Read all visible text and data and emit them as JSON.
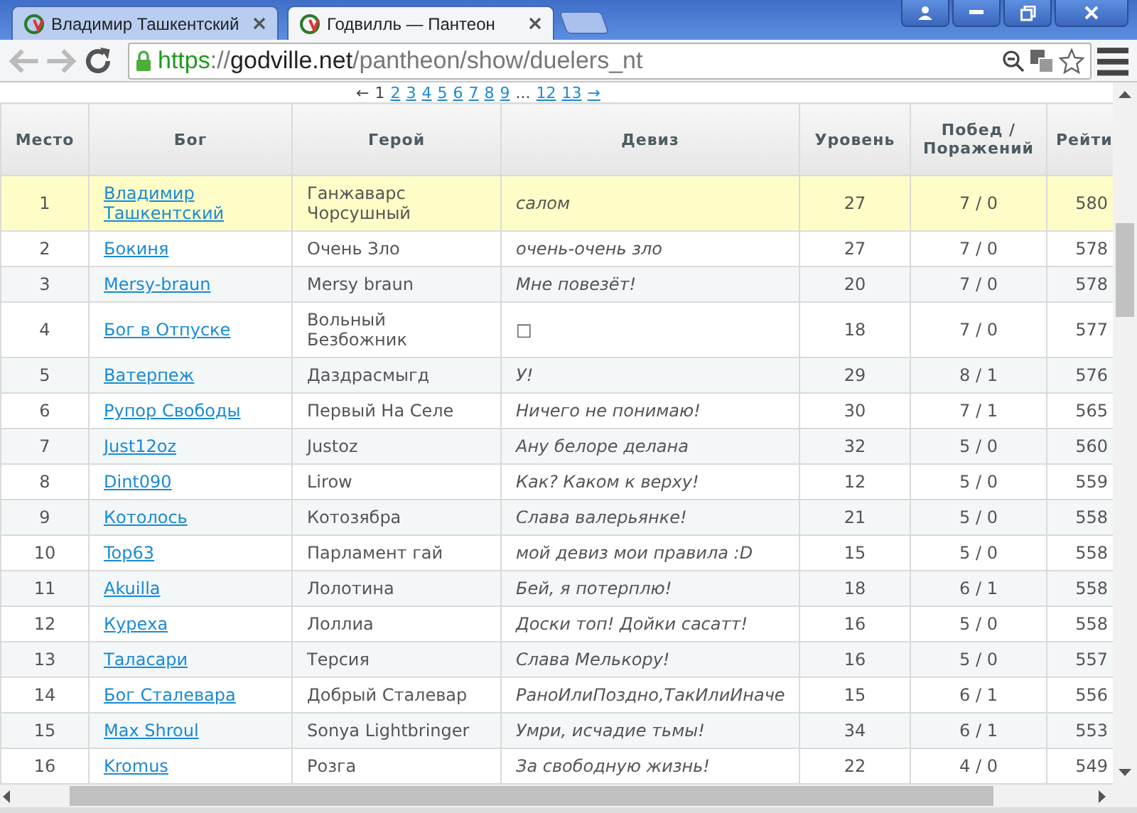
{
  "browser": {
    "tabs": [
      {
        "title": "Владимир Ташкентский",
        "selected": false
      },
      {
        "title": "Годвилль — Пантеон",
        "selected": true
      }
    ],
    "address": {
      "scheme": "https",
      "separator": "://",
      "host": "godville.net",
      "path": "/pantheon/show/duelers_nt"
    }
  },
  "pager": [
    {
      "text": "←",
      "kind": "text"
    },
    {
      "text": "1",
      "kind": "current"
    },
    {
      "text": "2",
      "kind": "link"
    },
    {
      "text": "3",
      "kind": "link"
    },
    {
      "text": "4",
      "kind": "link"
    },
    {
      "text": "5",
      "kind": "link"
    },
    {
      "text": "6",
      "kind": "link"
    },
    {
      "text": "7",
      "kind": "link"
    },
    {
      "text": "8",
      "kind": "link"
    },
    {
      "text": "9",
      "kind": "link"
    },
    {
      "text": "...",
      "kind": "text"
    },
    {
      "text": "12",
      "kind": "link"
    },
    {
      "text": "13",
      "kind": "link"
    },
    {
      "text": "→",
      "kind": "link"
    }
  ],
  "table": {
    "columns": [
      "Место",
      "Бог",
      "Герой",
      "Девиз",
      "Уровень",
      "Побед / Поражений",
      "Рейти"
    ],
    "rows": [
      {
        "place": "1",
        "god": "Владимир Ташкентский",
        "hero": "Ганжаварс Чорсушный",
        "motto": "салом",
        "level": "27",
        "wins_losses": "7 / 0",
        "column_7": "580",
        "highlighted": true
      },
      {
        "place": "2",
        "god": "Бокиня",
        "hero": "Очень Зло",
        "motto": "очень-очень зло",
        "level": "27",
        "wins_losses": "7 / 0",
        "column_7": "578",
        "highlighted": false
      },
      {
        "place": "3",
        "god": "Mersy-braun",
        "hero": "Mersy braun",
        "motto": "Мне повезёт!",
        "level": "20",
        "wins_losses": "7 / 0",
        "column_7": "578",
        "highlighted": false
      },
      {
        "place": "4",
        "god": "Бог в Отпуске",
        "hero": "Вольный Безбожник",
        "motto": "□",
        "level": "18",
        "wins_losses": "7 / 0",
        "column_7": "577",
        "highlighted": false
      },
      {
        "place": "5",
        "god": "Ватерпеж",
        "hero": "Даздрасмыгд",
        "motto": "У!",
        "level": "29",
        "wins_losses": "8 / 1",
        "column_7": "576",
        "highlighted": false
      },
      {
        "place": "6",
        "god": "Рупор Свободы",
        "hero": "Первый На Селе",
        "motto": "Ничего не понимаю!",
        "level": "30",
        "wins_losses": "7 / 1",
        "column_7": "565",
        "highlighted": false
      },
      {
        "place": "7",
        "god": "Just12oz",
        "hero": "Justoz",
        "motto": "Ану белоре делана",
        "level": "32",
        "wins_losses": "5 / 0",
        "column_7": "560",
        "highlighted": false
      },
      {
        "place": "8",
        "god": "Dint090",
        "hero": "Lirow",
        "motto": "Как? Каком к верху!",
        "level": "12",
        "wins_losses": "5 / 0",
        "column_7": "559",
        "highlighted": false
      },
      {
        "place": "9",
        "god": "Котолось",
        "hero": "Котозябра",
        "motto": "Слава валерьянке!",
        "level": "21",
        "wins_losses": "5 / 0",
        "column_7": "558",
        "highlighted": false
      },
      {
        "place": "10",
        "god": "Top63",
        "hero": "Парламент гай",
        "motto": "мой девиз мои правила :D",
        "level": "15",
        "wins_losses": "5 / 0",
        "column_7": "558",
        "highlighted": false
      },
      {
        "place": "11",
        "god": "Akuilla",
        "hero": "Лолотина",
        "motto": "Бей, я потерплю!",
        "level": "18",
        "wins_losses": "6 / 1",
        "column_7": "558",
        "highlighted": false
      },
      {
        "place": "12",
        "god": "Куреха",
        "hero": "Лоллиа",
        "motto": "Доски топ! Дойки сасатт!",
        "level": "16",
        "wins_losses": "5 / 0",
        "column_7": "558",
        "highlighted": false
      },
      {
        "place": "13",
        "god": "Таласари",
        "hero": "Терсия",
        "motto": "Слава Мелькору!",
        "level": "16",
        "wins_losses": "5 / 0",
        "column_7": "557",
        "highlighted": false
      },
      {
        "place": "14",
        "god": "Бог Сталевара",
        "hero": "Добрый Сталевар",
        "motto": "РаноИлиПоздно,ТакИлиИначе",
        "level": "15",
        "wins_losses": "6 / 1",
        "column_7": "556",
        "highlighted": false
      },
      {
        "place": "15",
        "god": "Max Shroul",
        "hero": "Sonya Lightbringer",
        "motto": "Умри, исчадие тьмы!",
        "level": "34",
        "wins_losses": "6 / 1",
        "column_7": "553",
        "highlighted": false
      },
      {
        "place": "16",
        "god": "Kromus",
        "hero": "Розга",
        "motto": "За свободную жизнь!",
        "level": "22",
        "wins_losses": "4 / 0",
        "column_7": "549",
        "highlighted": false
      }
    ]
  }
}
